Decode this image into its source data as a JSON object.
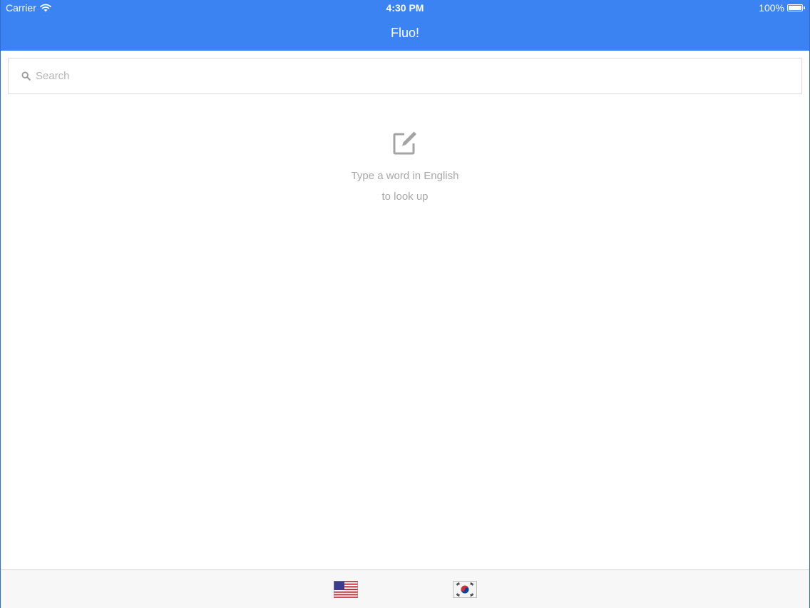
{
  "status_bar": {
    "carrier": "Carrier",
    "time": "4:30 PM",
    "battery": "100%",
    "battery_level": 1.0
  },
  "nav": {
    "title": "Fluo!"
  },
  "search": {
    "placeholder": "Search",
    "value": "",
    "icon": "search-icon"
  },
  "empty_state": {
    "icon": "edit-icon",
    "line1": "Type a word in English",
    "line2": "to look up"
  },
  "tab_bar": {
    "tabs": [
      {
        "name": "english",
        "icon": "us-flag-icon"
      },
      {
        "name": "korean",
        "icon": "korean-flag-icon"
      }
    ]
  },
  "colors": {
    "header": "#3b82f3",
    "placeholder": "#b4b4b4",
    "empty_text": "#a8a8a8",
    "tab_bar_bg": "#f7f7f7"
  }
}
